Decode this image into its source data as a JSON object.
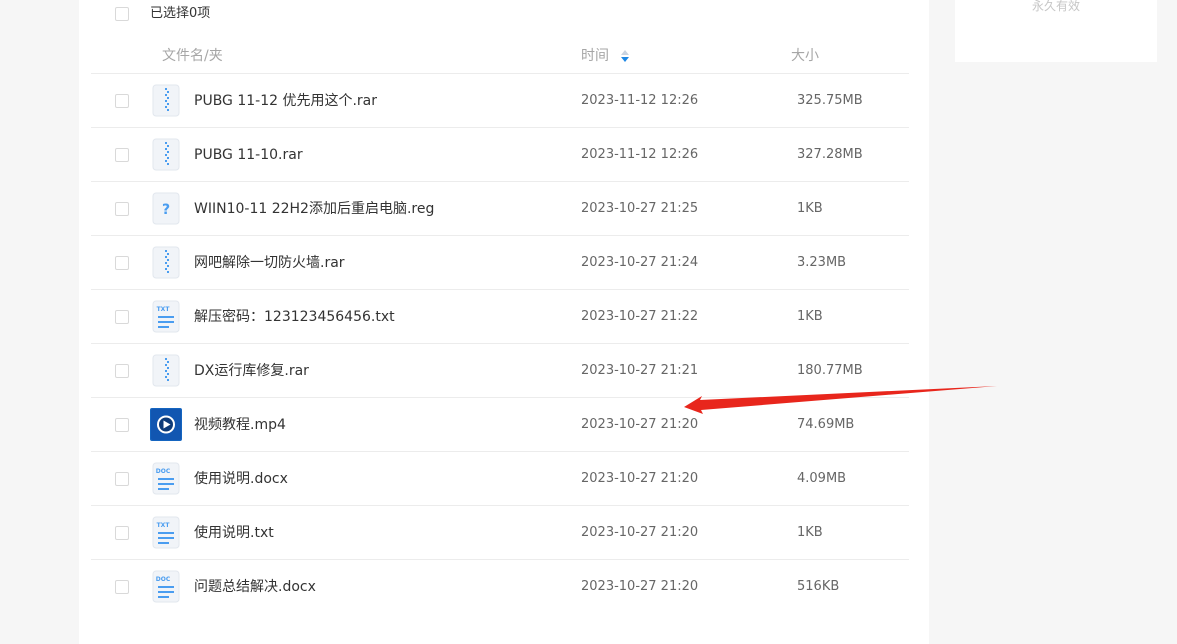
{
  "side_card": {
    "label": "永久有效"
  },
  "toolbar": {
    "selected_count": "已选择0项"
  },
  "table": {
    "headers": {
      "name": "文件名/夹",
      "time": "时间",
      "size": "大小"
    },
    "rows": [
      {
        "name": "PUBG 11-12 优先用这个.rar",
        "time": "2023-11-12 12:26",
        "size": "325.75MB",
        "icon": "zip-icon"
      },
      {
        "name": "PUBG 11-10.rar",
        "time": "2023-11-12 12:26",
        "size": "327.28MB",
        "icon": "zip-icon"
      },
      {
        "name": "WIIN10-11 22H2添加后重启电脑.reg",
        "time": "2023-10-27 21:25",
        "size": "1KB",
        "icon": "unknown-file-icon"
      },
      {
        "name": "网吧解除一切防火墙.rar",
        "time": "2023-10-27 21:24",
        "size": "3.23MB",
        "icon": "zip-icon"
      },
      {
        "name": "解压密码：123123456456.txt",
        "time": "2023-10-27 21:22",
        "size": "1KB",
        "icon": "txt-icon"
      },
      {
        "name": "DX运行库修复.rar",
        "time": "2023-10-27 21:21",
        "size": "180.77MB",
        "icon": "zip-icon"
      },
      {
        "name": "视频教程.mp4",
        "time": "2023-10-27 21:20",
        "size": "74.69MB",
        "icon": "video-icon"
      },
      {
        "name": "使用说明.docx",
        "time": "2023-10-27 21:20",
        "size": "4.09MB",
        "icon": "doc-icon"
      },
      {
        "name": "使用说明.txt",
        "time": "2023-10-27 21:20",
        "size": "1KB",
        "icon": "txt-icon"
      },
      {
        "name": "问题总结解决.docx",
        "time": "2023-10-27 21:20",
        "size": "516KB",
        "icon": "doc-icon"
      }
    ]
  },
  "icons": {
    "txt_label": "TXT",
    "doc_label": "DOC",
    "unknown_label": "?"
  },
  "colors": {
    "accent": "#1e88e5",
    "annotation_arrow": "#e8261c",
    "video_icon_bg": "#1565c0"
  }
}
